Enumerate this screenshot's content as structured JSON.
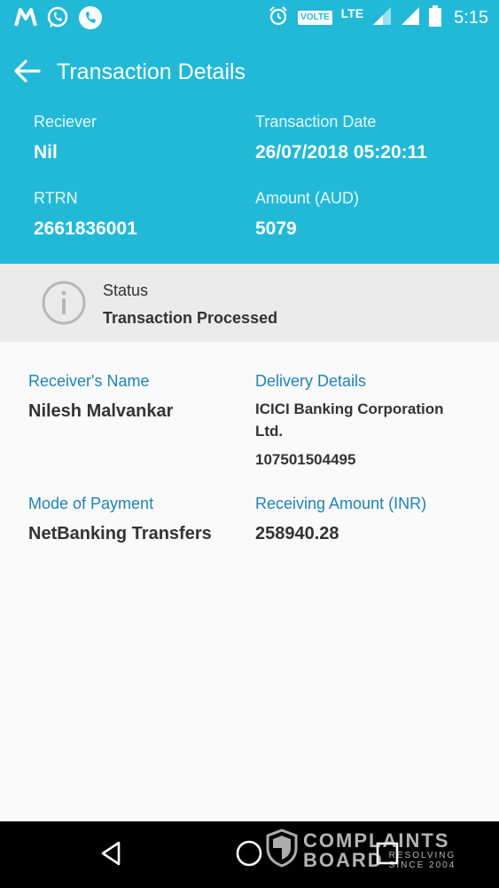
{
  "statusbar": {
    "volte": "VOLTE",
    "lte": "LTE",
    "time": "5:15"
  },
  "appbar": {
    "title": "Transaction Details"
  },
  "summary": {
    "receiver_label": "Reciever",
    "receiver_value": "Nil",
    "date_label": "Transaction Date",
    "date_value": "26/07/2018 05:20:11",
    "rtrn_label": "RTRN",
    "rtrn_value": "2661836001",
    "amount_label": "Amount (AUD)",
    "amount_value": "5079"
  },
  "status": {
    "label": "Status",
    "value": "Transaction Processed"
  },
  "details": {
    "receiver_name_label": "Receiver's Name",
    "receiver_name_value": "Nilesh Malvankar",
    "delivery_label": "Delivery Details",
    "delivery_bank_line1": "ICICI Banking Corporation",
    "delivery_bank_line2": "Ltd.",
    "delivery_account": "107501504495",
    "mode_label": "Mode of Payment",
    "mode_value": "NetBanking Transfers",
    "receiving_label": "Receiving Amount (INR)",
    "receiving_value": "258940.28"
  },
  "watermark": {
    "line1": "COMPLAINTS",
    "line2": "BOARD",
    "tag1": "RESOLVING",
    "tag2": "SINCE 2004"
  },
  "icons": [
    "gmail-m-icon",
    "whatsapp-icon",
    "phone-icon",
    "alarm-icon",
    "signal-icon",
    "battery-icon",
    "back-arrow-icon",
    "info-icon",
    "nav-back-icon",
    "nav-home-icon",
    "nav-recents-icon",
    "shield-logo-icon"
  ],
  "colors": {
    "header_bg": "#22b9d8",
    "accent_label": "#1f83b9",
    "status_bg": "#ebebeb"
  }
}
